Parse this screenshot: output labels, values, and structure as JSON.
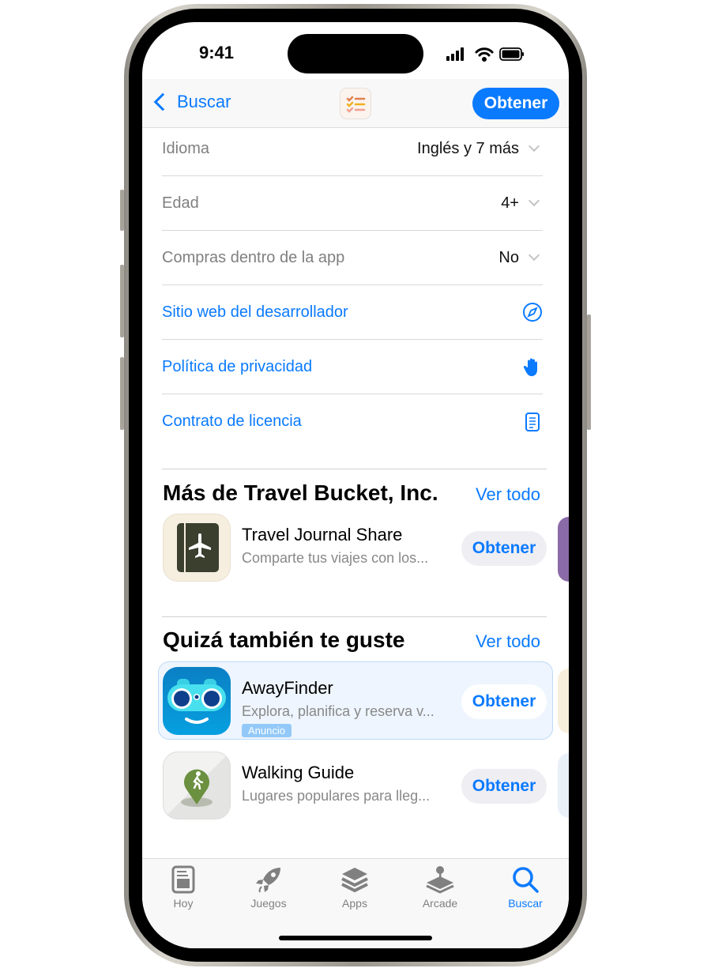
{
  "status": {
    "time": "9:41"
  },
  "nav": {
    "back_label": "Buscar",
    "get_label": "Obtener"
  },
  "info_rows": [
    {
      "key": "Idioma",
      "value": "Inglés y 7 más"
    },
    {
      "key": "Edad",
      "value": "4+"
    },
    {
      "key": "Compras dentro de la app",
      "value": "No"
    }
  ],
  "links": [
    {
      "label": "Sitio web del desarrollador",
      "icon": "compass-icon"
    },
    {
      "label": "Política de privacidad",
      "icon": "hand-icon"
    },
    {
      "label": "Contrato de licencia",
      "icon": "document-icon"
    }
  ],
  "more_from": {
    "title": "Más de Travel Bucket, Inc.",
    "see_all": "Ver todo",
    "apps": [
      {
        "name": "Travel Journal Share",
        "desc": "Comparte tus viajes con los...",
        "get": "Obtener"
      }
    ]
  },
  "you_may_like": {
    "title": "Quizá también te guste",
    "see_all": "Ver todo",
    "apps": [
      {
        "name": "AwayFinder",
        "desc": "Explora, planifica y reserva v...",
        "badge": "Anuncio",
        "get": "Obtener"
      },
      {
        "name": "Walking Guide",
        "desc": "Lugares populares para lleg...",
        "get": "Obtener"
      }
    ]
  },
  "tabs": [
    {
      "label": "Hoy"
    },
    {
      "label": "Juegos"
    },
    {
      "label": "Apps"
    },
    {
      "label": "Arcade"
    },
    {
      "label": "Buscar",
      "active": true
    }
  ],
  "colors": {
    "accent": "#0a7aff",
    "inactive": "#808080"
  }
}
